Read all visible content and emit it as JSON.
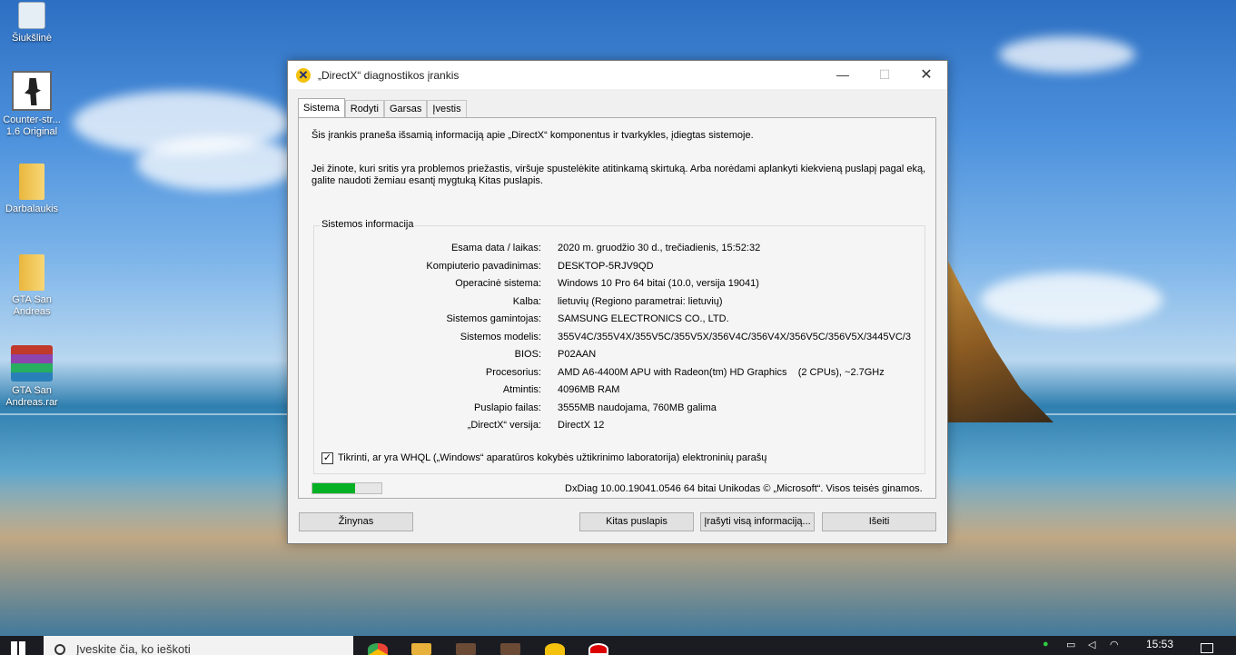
{
  "desktop": {
    "icons": [
      {
        "label": "Šiukšlinė"
      },
      {
        "label": "Counter-str... 1.6 Original"
      },
      {
        "label": "Darbalaukis"
      },
      {
        "label": "GTA San Andreas"
      },
      {
        "label": "GTA San Andreas.rar"
      }
    ]
  },
  "window": {
    "title": "„DirectX“ diagnostikos įrankis",
    "controls": {
      "minimize": "—",
      "maximize": "☐",
      "close": "✕"
    },
    "tabs": [
      {
        "label": "Sistema"
      },
      {
        "label": "Rodyti"
      },
      {
        "label": "Garsas"
      },
      {
        "label": "Įvestis"
      }
    ],
    "intro_line1": "Šis įrankis praneša išsamią informaciją apie „DirectX“ komponentus ir tvarkykles, įdiegtas sistemoje.",
    "intro_line2": "Jei žinote, kuri sritis yra problemos priežastis, viršuje spustelėkite atitinkamą skirtuką.  Arba norėdami aplankyti kiekvieną puslapį pagal eką, galite naudoti žemiau esantį mygtuką Kitas puslapis.",
    "group_title": "Sistemos informacija",
    "system_info": [
      {
        "label": "Esama data / laikas:",
        "value": "2020 m. gruodžio 30 d., trečiadienis, 15:52:32"
      },
      {
        "label": "Kompiuterio pavadinimas:",
        "value": "DESKTOP-5RJV9QD"
      },
      {
        "label": "Operacinė sistema:",
        "value": "Windows 10 Pro 64 bitai (10.0, versija 19041)"
      },
      {
        "label": "Kalba:",
        "value": "lietuvių (Regiono parametrai: lietuvių)"
      },
      {
        "label": "Sistemos gamintojas:",
        "value": "SAMSUNG ELECTRONICS CO., LTD."
      },
      {
        "label": "Sistemos modelis:",
        "value": "355V4C/355V4X/355V5C/355V5X/356V4C/356V4X/356V5C/356V5X/3445VC/3"
      },
      {
        "label": "BIOS:",
        "value": "P02AAN"
      },
      {
        "label": "Procesorius:",
        "value": "AMD A6-4400M APU with Radeon(tm) HD Graphics    (2 CPUs), ~2.7GHz"
      },
      {
        "label": "Atmintis:",
        "value": "4096MB RAM"
      },
      {
        "label": "Puslapio failas:",
        "value": "3555MB naudojama, 760MB galima"
      },
      {
        "label": "„DirectX“ versija:",
        "value": "DirectX 12"
      }
    ],
    "whql_label": "Tikrinti, ar yra WHQL („Windows“ aparatūros kokybės užtikrinimo laboratorija) elektroninių parašų",
    "whql_checked": "✓",
    "progress_fraction": 0.62,
    "status_text": "DxDiag 10.00.19041.0546 64 bitai Unikodas  © „Microsoft“. Visos teisės ginamos.",
    "buttons": {
      "help": "Žinynas",
      "next_page": "Kitas puslapis",
      "save_all": "Įrašyti visą informaciją...",
      "exit": "Išeiti"
    }
  },
  "taskbar": {
    "search_placeholder": "Įveskite čia, ko ieškoti",
    "clock": "15:53"
  }
}
